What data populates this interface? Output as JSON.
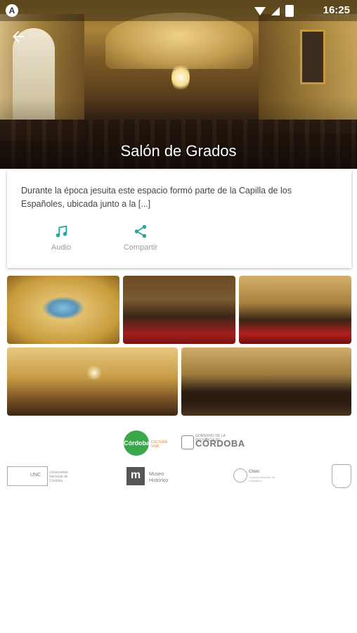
{
  "status_bar": {
    "app_letter": "A",
    "time": "16:25",
    "icons": [
      "wifi-icon",
      "signal-icon",
      "battery-icon"
    ]
  },
  "header": {
    "title": "Salón de Grados",
    "back_icon": "arrow-left-icon"
  },
  "card": {
    "description": "Durante la época jesuita este espacio formó parte de la Capilla de los Españoles, ubicada junto a la [...]",
    "actions": [
      {
        "label": "Audio",
        "icon": "music-note-icon"
      },
      {
        "label": "Compartir",
        "icon": "share-icon"
      }
    ],
    "accent_color": "#26a69a"
  },
  "gallery": {
    "images": [
      "painted-ceiling-photo",
      "hall-stage-photo",
      "hall-overview-photo",
      "chandelier-hall-photo",
      "hall-seats-photo"
    ]
  },
  "sponsors": {
    "row1": {
      "cordoba_logo_text": "Córdoba",
      "cordoba_tagline": "CULTURA VIVA",
      "gob_small": "GOBIERNO DE LA PROVINCIA DE",
      "gob_big": "CÓRDOBA"
    },
    "row2": {
      "unc_short": "UNC",
      "unc_name": "Universidad Nacional de Córdoba",
      "museo_letter": "m",
      "museo_line1": "Museo",
      "museo_line2": "Histórico",
      "chini_title": "Chini",
      "chini_sub": "Consejo Nacional de Educación"
    }
  }
}
